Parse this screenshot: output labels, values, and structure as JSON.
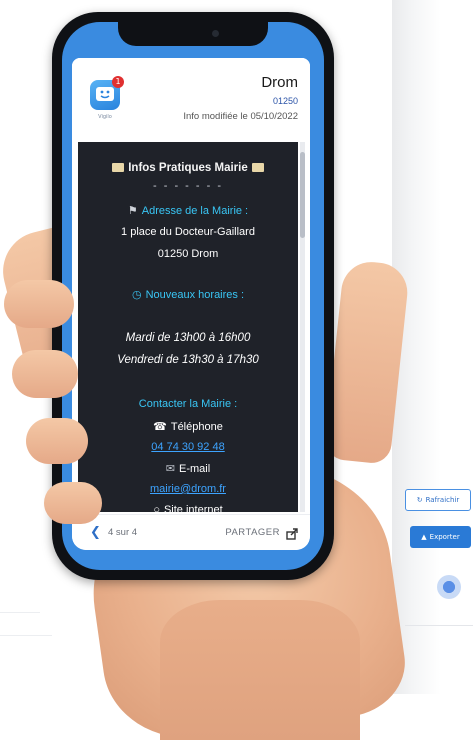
{
  "background_app": {
    "refresh_label": "Rafraichir",
    "export_label": "Exporter",
    "accent_color": "#2a7ad6"
  },
  "header": {
    "app_name": "Vigilo",
    "badge_count": "1",
    "town": "Drom",
    "postal_code": "01250",
    "modified": "Info modifiée le 05/10/2022"
  },
  "content": {
    "title": "Infos Pratiques Mairie",
    "separator": "- - - - - - -",
    "address_heading": "Adresse de la Mairie :",
    "address_line1": "1 place du Docteur-Gaillard",
    "address_line2": "01250 Drom",
    "hours_heading": "Nouveaux horaires :",
    "hours_line1": "Mardi de 13h00 à 16h00",
    "hours_line2": "Vendredi de 13h30 à 17h30",
    "contact_heading": "Contacter la Mairie :",
    "phone_label": "Téléphone",
    "phone_value": "04 74 30 92 48",
    "email_label": "E-mail",
    "email_value": "mairie@drom.fr",
    "site_label": "Site internet"
  },
  "footer": {
    "pager": "4 sur 4",
    "share_label": "PARTAGER"
  },
  "icons": [
    "refresh-icon",
    "upload-icon",
    "app-face-icon",
    "book-icon",
    "pin-icon",
    "clock-icon",
    "phone-icon",
    "mail-icon",
    "globe-icon",
    "chevron-left-icon",
    "share-icon"
  ],
  "colors": {
    "phone_frame": "#3a8be0",
    "content_bg": "#1f2229",
    "heading_cyan": "#39c6f5",
    "link_blue": "#3da4ff"
  }
}
